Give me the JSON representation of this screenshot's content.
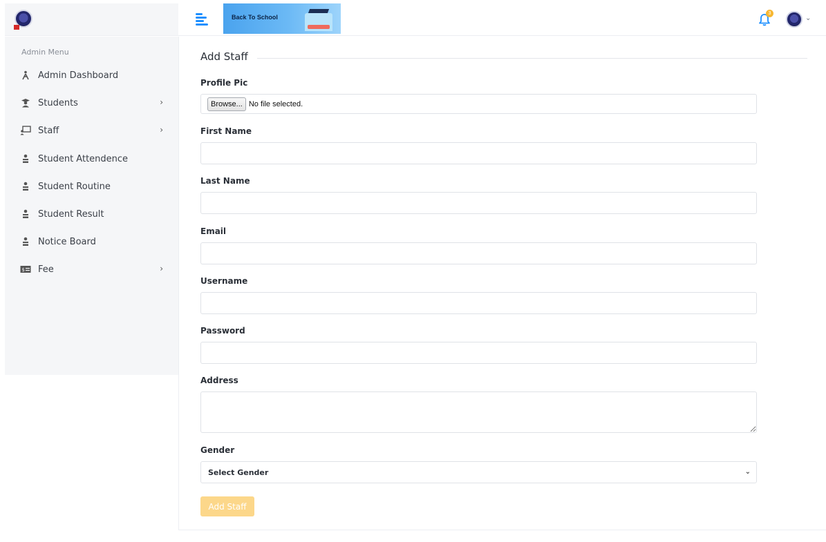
{
  "header": {
    "banner_text": "Back To School",
    "notification_count": "3",
    "accent_color": "#1e90ff",
    "badge_color": "#f7b731"
  },
  "sidebar": {
    "title": "Admin Menu",
    "items": [
      {
        "label": "Admin Dashboard",
        "icon": "dashboard-person-icon",
        "has_children": false
      },
      {
        "label": "Students",
        "icon": "student-icon",
        "has_children": true
      },
      {
        "label": "Staff",
        "icon": "chalkboard-teacher-icon",
        "has_children": true
      },
      {
        "label": "Student Attendence",
        "icon": "user-desk-icon",
        "has_children": false
      },
      {
        "label": "Student Routine",
        "icon": "user-desk-icon",
        "has_children": false
      },
      {
        "label": "Student Result",
        "icon": "user-desk-icon",
        "has_children": false
      },
      {
        "label": "Notice Board",
        "icon": "user-desk-icon",
        "has_children": false
      },
      {
        "label": "Fee",
        "icon": "money-bill-icon",
        "has_children": true
      }
    ]
  },
  "form": {
    "title": "Add Staff",
    "profile_pic_label": "Profile Pic",
    "browse_label": "Browse...",
    "file_status": "No file selected.",
    "first_name_label": "First Name",
    "first_name_value": "",
    "last_name_label": "Last Name",
    "last_name_value": "",
    "email_label": "Email",
    "email_value": "",
    "username_label": "Username",
    "username_value": "",
    "password_label": "Password",
    "password_value": "",
    "address_label": "Address",
    "address_value": "",
    "gender_label": "Gender",
    "gender_selected": "Select Gender",
    "submit_label": "Add Staff",
    "submit_color": "#fcd78a"
  }
}
